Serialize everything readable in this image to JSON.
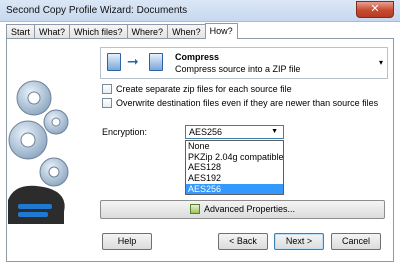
{
  "window": {
    "title": "Second Copy Profile Wizard: Documents",
    "close_label": "✕"
  },
  "tabs": [
    {
      "label": "Start"
    },
    {
      "label": "What?"
    },
    {
      "label": "Which files?"
    },
    {
      "label": "Where?"
    },
    {
      "label": "When?"
    },
    {
      "label": "How?"
    }
  ],
  "action": {
    "name": "Compress",
    "description": "Compress source into a ZIP file",
    "arrow": "➞",
    "dropdown_glyph": "▾"
  },
  "checkboxes": [
    {
      "label": "Create separate zip files for each source file",
      "checked": false
    },
    {
      "label": "Overwrite destination files even if they are newer than source files",
      "checked": false
    }
  ],
  "encryption": {
    "label": "Encryption:",
    "value": "AES256",
    "dropdown_glyph": "▼",
    "options": [
      "None",
      "PKZip 2.04g compatible",
      "AES128",
      "AES192",
      "AES256"
    ],
    "selected_index": 4
  },
  "advanced_button": {
    "label": "Advanced Properties..."
  },
  "buttons": {
    "help": "Help",
    "back": "< Back",
    "next": "Next >",
    "cancel": "Cancel"
  },
  "colors": {
    "selection": "#3399ff",
    "close": "#c74a31",
    "icon_blue": "#2f63a8"
  }
}
